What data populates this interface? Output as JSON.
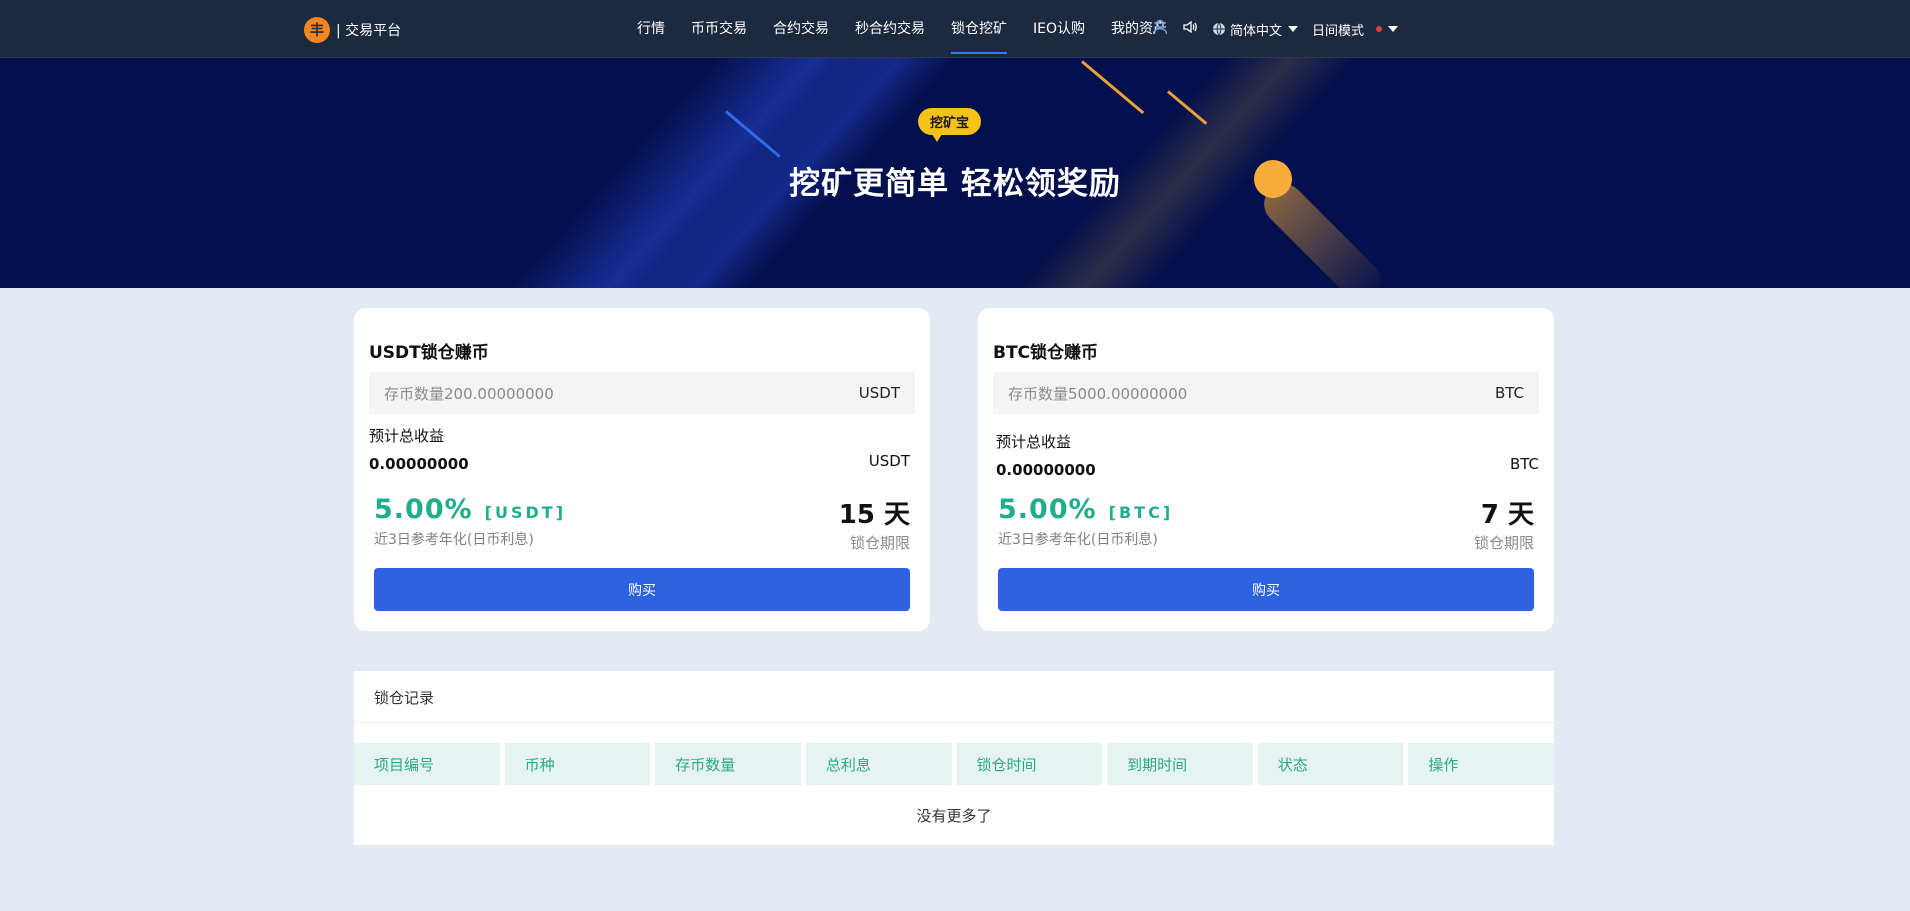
{
  "nav": {
    "logo_glyph": "丰",
    "logo_text": "| 交易平台",
    "links": [
      {
        "label": "行情"
      },
      {
        "label": "币币交易"
      },
      {
        "label": "合约交易"
      },
      {
        "label": "秒合约交易"
      },
      {
        "label": "锁仓挖矿",
        "active": true
      },
      {
        "label": "IEO认购"
      },
      {
        "label": "我的资产"
      }
    ],
    "language": "简体中文",
    "mode": "日间模式"
  },
  "hero": {
    "badge": "挖矿宝",
    "title": "挖矿更简单 轻松领奖励"
  },
  "cards": [
    {
      "title": "USDT锁仓赚币",
      "amount_placeholder": "存币数量200.00000000",
      "coin": "USDT",
      "est_label": "预计总收益",
      "est_value": "0.00000000",
      "rate": "5.00%",
      "rate_coin": "[USDT]",
      "rate_desc": "近3日参考年化(日币利息)",
      "lock_days": "15 天",
      "lock_label": "锁仓期限",
      "buy": "购买"
    },
    {
      "title": "BTC锁仓赚币",
      "amount_placeholder": "存币数量5000.00000000",
      "coin": "BTC",
      "est_label": "预计总收益",
      "est_value": "0.00000000",
      "rate": "5.00%",
      "rate_coin": "[BTC]",
      "rate_desc": "近3日参考年化(日币利息)",
      "lock_days": "7 天",
      "lock_label": "锁仓期限",
      "buy": "购买"
    }
  ],
  "records": {
    "title": "锁仓记录",
    "columns": [
      "项目编号",
      "币种",
      "存币数量",
      "总利息",
      "锁仓时间",
      "到期时间",
      "状态",
      "操作"
    ],
    "empty": "没有更多了"
  },
  "colors": {
    "nav_bg": "#1c2a40",
    "hero_bg": "#04104d",
    "accent_green": "#1fae8b",
    "button_blue": "#2e62e0",
    "badge_yellow": "#f5c218"
  }
}
